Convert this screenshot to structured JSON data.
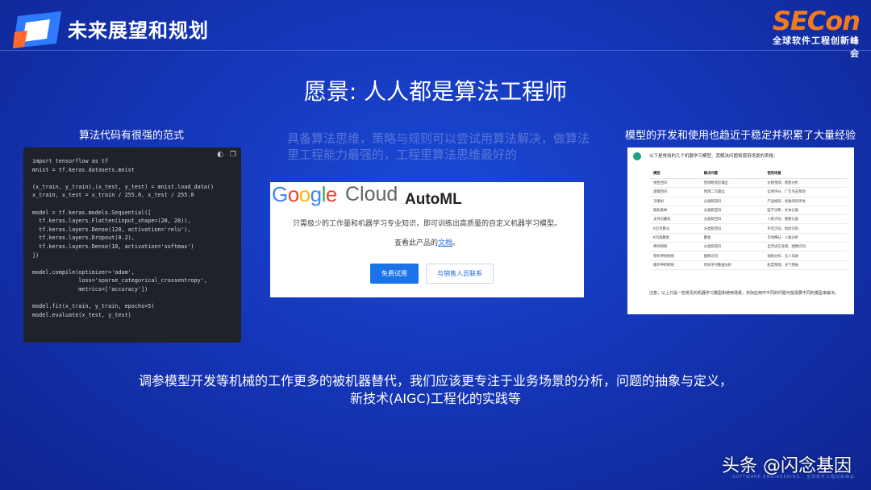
{
  "header": {
    "title": "未来展望和规划",
    "brand_name": "SECon",
    "brand_sub": "全球软件工程创新峰会",
    "colors": {
      "brand_orange": "#f47a20",
      "background": "#1536b8"
    }
  },
  "vision": "愿景: 人人都是算法工程师",
  "left": {
    "caption": "算法代码有很强的范式",
    "code_lines": [
      "import tensorflow as tf",
      "mnist = tf.keras.datasets.mnist",
      "",
      "(x_train, y_train),(x_test, y_test) = mnist.load_data()",
      "x_train, x_test = x_train / 255.0, x_test / 255.0",
      "",
      "model = tf.keras.models.Sequential([",
      "  tf.keras.layers.Flatten(input_shape=(28, 28)),",
      "  tf.keras.layers.Dense(128, activation='relu'),",
      "  tf.keras.layers.Dropout(0.2),",
      "  tf.keras.layers.Dense(10, activation='softmax')",
      "])",
      "",
      "model.compile(optimizer='adam',",
      "              loss='sparse_categorical_crossentropy',",
      "              metrics=['accuracy'])",
      "",
      "model.fit(x_train, y_train, epochs=5)",
      "model.evaluate(x_test, y_test)"
    ]
  },
  "middle": {
    "subtext": "具备算法思维，策略与规则可以尝试用算法解决，做算法里工程能力最强的，工程里算法思维最好的",
    "google_letters": [
      {
        "ch": "G",
        "color": "#4285f4"
      },
      {
        "ch": "o",
        "color": "#ea4335"
      },
      {
        "ch": "o",
        "color": "#fbbc05"
      },
      {
        "ch": "g",
        "color": "#4285f4"
      },
      {
        "ch": "l",
        "color": "#34a853"
      },
      {
        "ch": "e",
        "color": "#ea4335"
      }
    ],
    "cloud": "Cloud",
    "product": "AutoML",
    "description": "只需极少的工作量和机器学习专业知识，即可训练出高质量的自定义机器学习模型。",
    "docs_prefix": "查看此产品的",
    "docs_link": "文档",
    "docs_suffix": "。",
    "btn_try": "免费试用",
    "btn_sales": "与销售人员联系"
  },
  "right": {
    "caption": "模型的开发和使用也趋近于稳定并积累了大量经验",
    "intro": "以下是常用的几个机器学习模型、其解决问题和使用场景的表格：",
    "columns": [
      "模型",
      "解决问题",
      "使用场景"
    ],
    "rows": [
      [
        "线性回归",
        "预测数值型输出",
        "价格预测、销售分析"
      ],
      [
        "逻辑回归",
        "预测二元输出",
        "信用评分、广告点击预测"
      ],
      [
        "决策树",
        "分类和回归",
        "产品推荐、金融风险评估"
      ],
      [
        "随机森林",
        "分类和回归",
        "医学诊断、文本分类"
      ],
      [
        "支持向量机",
        "分类和回归",
        "人脸识别、图像分类"
      ],
      [
        "K近邻算法",
        "分类和回归",
        "声音识别、指纹识别"
      ],
      [
        "K均值聚类",
        "聚类",
        "市场细分、人群分析"
      ],
      [
        "神经网络",
        "分类和回归",
        "自然语言处理、图像识别"
      ],
      [
        "卷积神经网络",
        "图像识别",
        "视频分析、无人驾驶"
      ],
      [
        "循环神经网络",
        "时间序列数据分析",
        "股票预测、天气预报"
      ]
    ],
    "note": "注意，以上只是一些常见的机器学习模型和使用场景，实际应用中不同的问题可能需要不同的模型来解决。"
  },
  "conclusion_line1": "调参模型开发等机械的工作更多的被机器替代，我们应该更专注于业务场景的分析，问题的抽象与定义，",
  "conclusion_line2": "新技术(AIGC)工程化的实践等",
  "watermark": "头条 @闪念基因",
  "footer": "SOFTWARE ENGINEERING · 全球软件工程创新峰会"
}
